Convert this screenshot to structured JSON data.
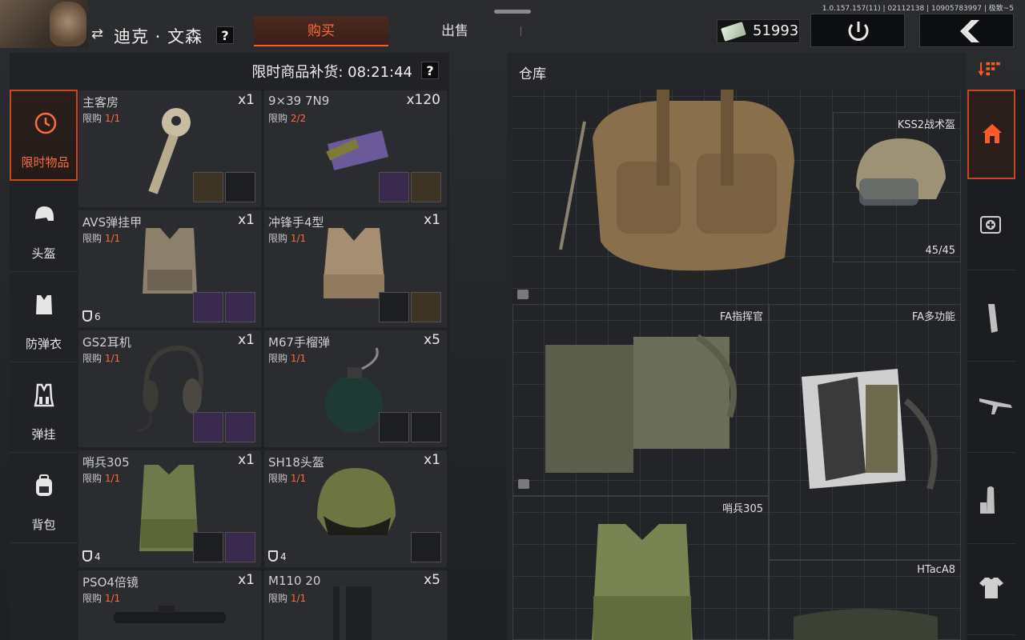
{
  "version": "1.0.157.157(11) | 02112138 | 10905783997 | 极致~5",
  "player": {
    "name": "迪克 · 文森",
    "help": "?"
  },
  "tabs": {
    "buy": "购买",
    "sell": "出售"
  },
  "money": "51993",
  "restock": {
    "label": "限时商品补货: 08:21:44",
    "help": "?"
  },
  "categories": [
    {
      "label": "限时物品",
      "icon": "clock-icon"
    },
    {
      "label": "头盔",
      "icon": "helmet-icon"
    },
    {
      "label": "防弹衣",
      "icon": "vest-icon"
    },
    {
      "label": "弹挂",
      "icon": "rig-icon"
    },
    {
      "label": "背包",
      "icon": "backpack-icon"
    }
  ],
  "items": [
    {
      "name": "主客房",
      "qty": "x1",
      "limit_prefix": "限购",
      "limit": "1/1"
    },
    {
      "name": "9×39 7N9",
      "qty": "x120",
      "limit_prefix": "限购",
      "limit": "2/2"
    },
    {
      "name": "AVS弹挂甲",
      "qty": "x1",
      "limit_prefix": "限购",
      "limit": "1/1",
      "armor": "6"
    },
    {
      "name": "冲锋手4型",
      "qty": "x1",
      "limit_prefix": "限购",
      "limit": "1/1"
    },
    {
      "name": "GS2耳机",
      "qty": "x1",
      "limit_prefix": "限购",
      "limit": "1/1"
    },
    {
      "name": "M67手榴弹",
      "qty": "x5",
      "limit_prefix": "限购",
      "limit": "1/1"
    },
    {
      "name": "哨兵305",
      "qty": "x1",
      "limit_prefix": "限购",
      "limit": "1/1",
      "armor": "4"
    },
    {
      "name": "SH18头盔",
      "qty": "x1",
      "limit_prefix": "限购",
      "limit": "1/1",
      "armor": "4"
    },
    {
      "name": "PSO4倍镜",
      "qty": "x1",
      "limit_prefix": "限购",
      "limit": "1/1"
    },
    {
      "name": "M110 20",
      "qty": "x5",
      "limit_prefix": "限购",
      "limit": "1/1"
    }
  ],
  "warehouse": {
    "title": "仓库",
    "entries": [
      {
        "label": "KSS2战术盔",
        "durability": "45/45"
      },
      {
        "label": "FA指挥官"
      },
      {
        "label": "FA多功能"
      },
      {
        "label": "哨兵305"
      },
      {
        "label": "HTacA8"
      }
    ]
  },
  "right_nav": [
    "home-icon",
    "medkit-icon",
    "magazine-icon",
    "rifle-icon",
    "ammo-icon",
    "shirt-icon"
  ],
  "colors": {
    "accent": "#ff6b3d",
    "accent_border": "#c9461f",
    "bg": "#202225"
  }
}
